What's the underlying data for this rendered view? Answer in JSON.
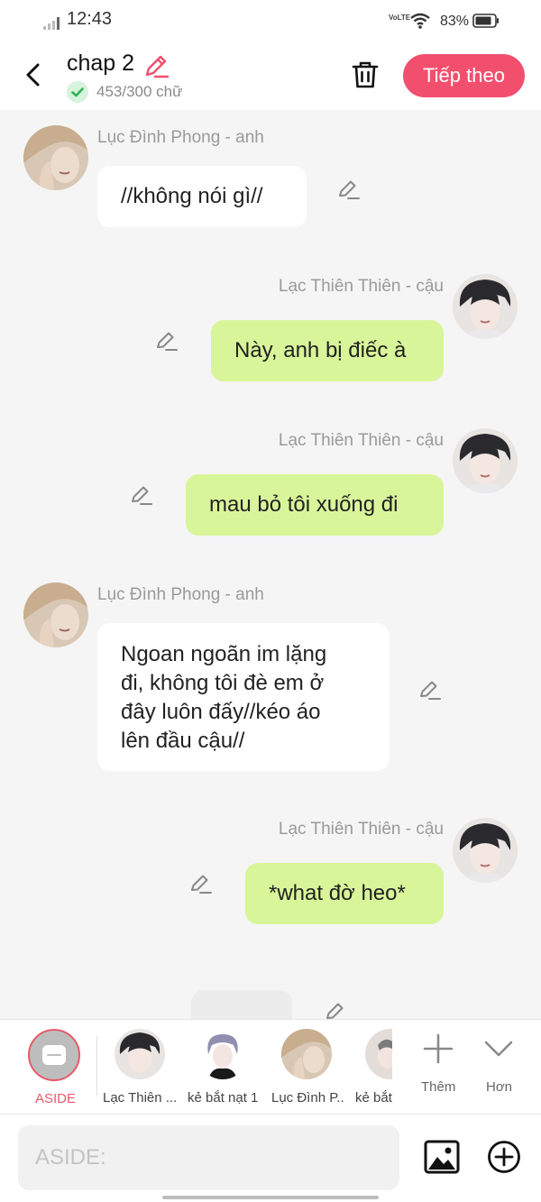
{
  "status_bar": {
    "time": "12:43",
    "network_label": "VoLTE",
    "battery": "83%"
  },
  "header": {
    "title": "chap 2",
    "word_count": "453/300 chữ",
    "next_label": "Tiếp theo"
  },
  "messages": [
    {
      "sender": "Lục Đình Phong - anh",
      "text": "//không nói gì//",
      "side": "left"
    },
    {
      "sender": "Lạc Thiên Thiên - cậu",
      "text": "Này, anh bị điếc à",
      "side": "right"
    },
    {
      "sender": "Lạc Thiên Thiên - cậu",
      "text": "mau bỏ tôi xuống đi",
      "side": "right"
    },
    {
      "sender": "Lục Đình Phong - anh",
      "lines": [
        "Ngoan ngoãn im lặng",
        "đi, không tôi đè em ở",
        "đây luôn đấy//kéo áo",
        "lên đầu cậu//"
      ],
      "side": "left"
    },
    {
      "sender": "Lạc Thiên Thiên - cậu",
      "text": "*what đờ heo*",
      "side": "right"
    }
  ],
  "character_bar": {
    "aside_label": "ASIDE",
    "characters": [
      {
        "label": "Lạc Thiên ..."
      },
      {
        "label": "kẻ bắt nạt 1"
      },
      {
        "label": "Lục Đình P..."
      },
      {
        "label": "kẻ bắt"
      }
    ],
    "add_label": "Thêm",
    "more_label": "Hơn"
  },
  "input": {
    "placeholder": "ASIDE:"
  },
  "colors": {
    "accent": "#f24f6e",
    "right_bubble": "#d9f59a",
    "left_bubble": "#ffffff",
    "aside_red": "#e85a6a"
  },
  "icons": [
    "back-icon",
    "edit-icon",
    "check-icon",
    "trash-icon",
    "image-icon",
    "plus-circle-icon",
    "plus-icon",
    "chevron-down-icon"
  ]
}
